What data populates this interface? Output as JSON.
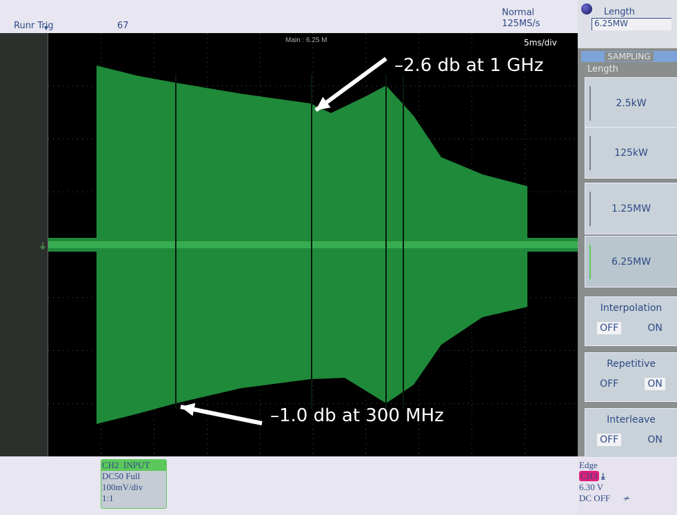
{
  "header": {
    "run_state": "Runr Trig",
    "count": "67",
    "mode": "Normal",
    "sample_rate": "125MS/s"
  },
  "screen": {
    "main_label": "Main : 6.25 M",
    "timebase": "5ms/div"
  },
  "annotations": {
    "top": "–2.6 db at 1 GHz",
    "bottom": "–1.0 db at 300 MHz"
  },
  "right_panel": {
    "length_title": "Length",
    "length_value": "6.25MW",
    "section": "SAMPLING",
    "group_label": "Length",
    "length_options": [
      {
        "label": "2.5kW",
        "selected": false
      },
      {
        "label": "125kW",
        "selected": false
      },
      {
        "label": "1.25MW",
        "selected": false
      },
      {
        "label": "6.25MW",
        "selected": true
      }
    ],
    "toggles": [
      {
        "title": "Interpolation",
        "off": "OFF",
        "on": "ON",
        "value": "OFF"
      },
      {
        "title": "Repetitive",
        "off": "OFF",
        "on": "ON",
        "value": "ON"
      },
      {
        "title": "Interleave",
        "off": "OFF",
        "on": "ON",
        "value": "OFF"
      }
    ]
  },
  "channel": {
    "title": "CH2  INPUT",
    "coupling": "DC50 Full",
    "scale": "100mV/div",
    "probe": "1:1",
    "color": "#5cc85c"
  },
  "trigger": {
    "type": "Edge",
    "source": "CH3",
    "source_color": "#e0207a",
    "level": "6.30 V",
    "coupling": "DC OFF"
  },
  "colors": {
    "trace": "#1f8a3a",
    "accent": "#2d4a86"
  }
}
